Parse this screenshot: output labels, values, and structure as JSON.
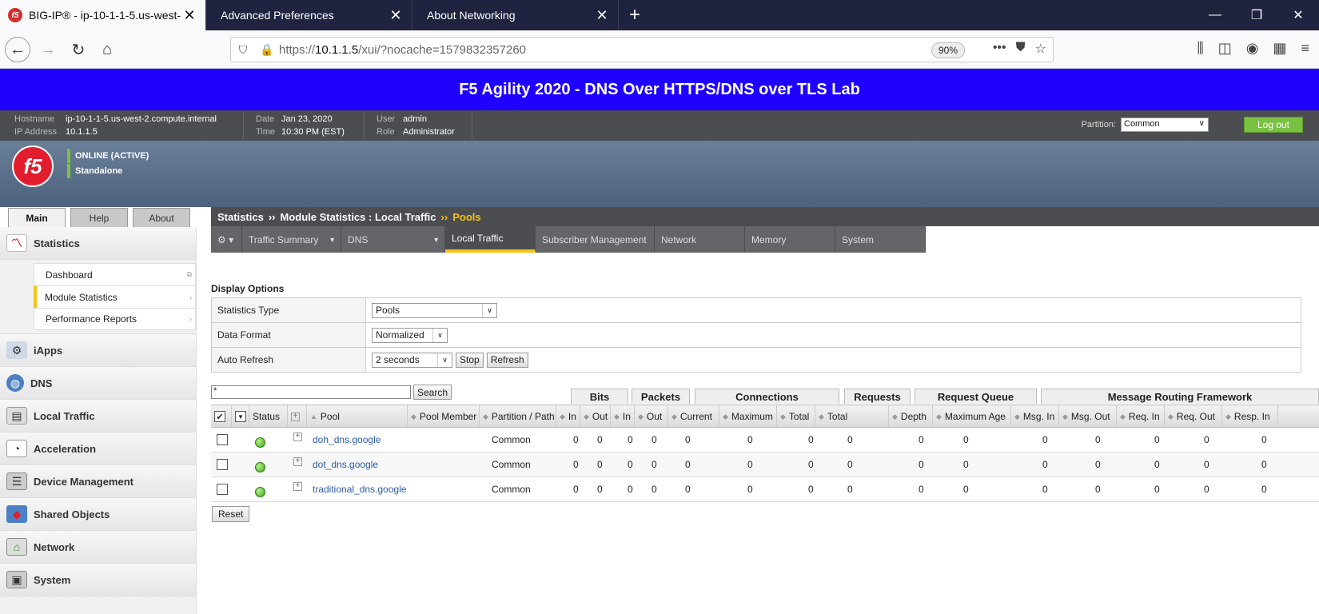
{
  "browser": {
    "tabs": [
      {
        "title": "BIG-IP® - ip-10-1-1-5.us-west-",
        "active": true
      },
      {
        "title": "Advanced Preferences",
        "active": false
      },
      {
        "title": "About Networking",
        "active": false
      }
    ],
    "url_prefix": "https://",
    "url_host": "10.1.1.5",
    "url_path": "/xui/?nocache=1579832357260",
    "zoom": "90%"
  },
  "banner": {
    "title": "F5 Agility 2020 - DNS Over HTTPS/DNS over TLS Lab"
  },
  "info": {
    "hostname_label": "Hostname",
    "hostname": "ip-10-1-1-5.us-west-2.compute.internal",
    "ip_label": "IP Address",
    "ip": "10.1.1.5",
    "date_label": "Date",
    "date": "Jan 23, 2020",
    "time_label": "Time",
    "time": "10:30 PM (EST)",
    "user_label": "User",
    "user": "admin",
    "role_label": "Role",
    "role": "Administrator",
    "partition_label": "Partition:",
    "partition": "Common",
    "logout": "Log out"
  },
  "device": {
    "logo": "f5",
    "status1": "ONLINE (ACTIVE)",
    "status2": "Standalone"
  },
  "main_tabs": [
    "Main",
    "Help",
    "About"
  ],
  "sidebar": {
    "statistics": "Statistics",
    "sub": [
      "Dashboard",
      "Module Statistics",
      "Performance Reports"
    ],
    "groups": [
      "iApps",
      "DNS",
      "Local Traffic",
      "Acceleration",
      "Device Management",
      "Shared Objects",
      "Network",
      "System"
    ]
  },
  "breadcrumb": {
    "p1": "Statistics",
    "sep1": "››",
    "p2": "Module Statistics : Local Traffic",
    "sep2": "››",
    "p3": "Pools"
  },
  "menu": [
    "Traffic Summary",
    "DNS",
    "Local Traffic",
    "Subscriber Management",
    "Network",
    "Memory",
    "System"
  ],
  "display_options": {
    "title": "Display Options",
    "stat_type_label": "Statistics Type",
    "stat_type": "Pools",
    "format_label": "Data Format",
    "format": "Normalized",
    "refresh_label": "Auto Refresh",
    "refresh": "2 seconds",
    "stop": "Stop",
    "refresh_btn": "Refresh"
  },
  "search": {
    "value": "*",
    "button": "Search"
  },
  "group_headers": [
    "Bits",
    "Packets",
    "Connections",
    "Requests",
    "Request Queue",
    "Message Routing Framework"
  ],
  "columns": [
    "Status",
    "Pool",
    "Pool Member",
    "Partition / Path",
    "In",
    "Out",
    "In",
    "Out",
    "Current",
    "Maximum",
    "Total",
    "Total",
    "Depth",
    "Maximum Age",
    "Msg. In",
    "Msg. Out",
    "Req. In",
    "Req. Out",
    "Resp. In"
  ],
  "rows": [
    {
      "pool": "doh_dns.google",
      "partition": "Common",
      "vals": [
        "0",
        "0",
        "0",
        "0",
        "0",
        "0",
        "0",
        "0",
        "0",
        "0",
        "0",
        "0",
        "0",
        "0",
        "0"
      ]
    },
    {
      "pool": "dot_dns.google",
      "partition": "Common",
      "vals": [
        "0",
        "0",
        "0",
        "0",
        "0",
        "0",
        "0",
        "0",
        "0",
        "0",
        "0",
        "0",
        "0",
        "0",
        "0"
      ]
    },
    {
      "pool": "traditional_dns.google",
      "partition": "Common",
      "vals": [
        "0",
        "0",
        "0",
        "0",
        "0",
        "0",
        "0",
        "0",
        "0",
        "0",
        "0",
        "0",
        "0",
        "0",
        "0"
      ]
    }
  ],
  "reset": "Reset"
}
